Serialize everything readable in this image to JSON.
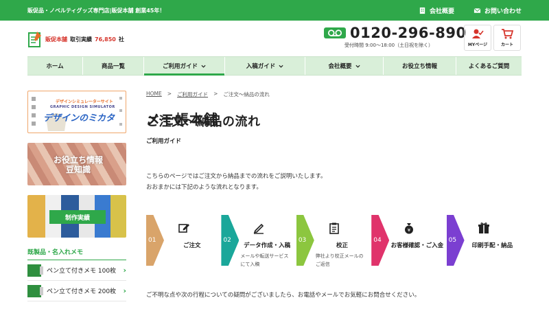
{
  "topbar": {
    "tagline": "販促品・ノベルティグッズ専門店|販促本舗 創業45年！",
    "company_label": "会社概要",
    "contact_label": "お問い合わせ"
  },
  "header": {
    "logo_main": "メモ帳本舗",
    "logo_brand": "販促本舗",
    "logo_record": "取引実績",
    "logo_count": "76,850",
    "logo_count_suffix": "社",
    "phone": "0120-296-890",
    "hours": "受付時間 9:00～18:00（土日祝を除く）",
    "mypage_label": "MYページ",
    "cart_label": "カート"
  },
  "nav": {
    "items": [
      {
        "label": "ホーム"
      },
      {
        "label": "商品一覧"
      },
      {
        "label": "ご利用ガイド"
      },
      {
        "label": "入稿ガイド"
      },
      {
        "label": "会社概要"
      },
      {
        "label": "お役立ち情報"
      },
      {
        "label": "よくあるご質問"
      }
    ]
  },
  "sidebar": {
    "banner1_top": "デザインシミュレーターサイト",
    "banner1_mid": "GRAPHIC DESIGN SIMULATOR",
    "banner1_main": "デザインのミカタ",
    "banner2_label_1": "お役立ち情報",
    "banner2_label_2": "豆知識",
    "banner3_label": "制作実績",
    "section_title": "既製品・名入れメモ",
    "items": [
      {
        "label": "ペン立て付きメモ 100枚"
      },
      {
        "label": "ペン立て付きメモ 200枚"
      }
    ]
  },
  "breadcrumb": {
    "home": "HOME",
    "guide": "ご利用ガイド",
    "current": "ご注文～納品の流れ",
    "sep": ">"
  },
  "main": {
    "title": "ご注文～納品の流れ",
    "subtitle": "ご利用ガイド",
    "intro_1": "こちらのページではご注文から納品までの流れをご説明いたします。",
    "intro_2": "おおまかには下記のような流れとなります。",
    "footnote": "ご不明な点や次の行程についての疑問がございましたら、お電話やメールでお気軽にお問合せください。"
  },
  "steps": [
    {
      "num": "01",
      "title": "ご注文",
      "desc_1": "",
      "desc_2": "",
      "color": "#d9a46a"
    },
    {
      "num": "02",
      "title": "データ作成・入稿",
      "desc_1": "メールや転送サービス",
      "desc_2": "にて入稿",
      "color": "#1aa79a"
    },
    {
      "num": "03",
      "title": "校正",
      "desc_1": "弊社より校正メールの",
      "desc_2": "ご返信",
      "color": "#8cc63f"
    },
    {
      "num": "04",
      "title": "お客様確認・ご入金",
      "desc_1": "",
      "desc_2": "",
      "color": "#e0336b"
    },
    {
      "num": "05",
      "title": "印刷手配・納品",
      "desc_1": "",
      "desc_2": "",
      "color": "#7b3fd1"
    }
  ],
  "colors": {
    "brand_green": "#2fa84a",
    "nav_bg": "#d9efd9",
    "accent_red": "#d6342b"
  }
}
